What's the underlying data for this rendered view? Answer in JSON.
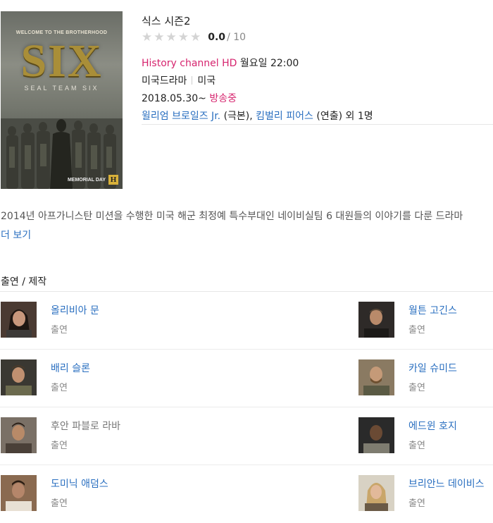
{
  "poster": {
    "tagline": "WELCOME TO THE BROTHERHOOD",
    "title": "SIX",
    "subtitle": "SEAL TEAM SIX",
    "footer": "MEMORIAL DAY",
    "logo": "H"
  },
  "show": {
    "title": "식스 시즌2",
    "rating": {
      "score": "0.0",
      "max": "/ 10",
      "stars_filled": 0,
      "stars_total": 5
    },
    "channel": "History channel HD",
    "schedule": "월요일 22:00",
    "genre": "미국드라마",
    "country": "미국",
    "date": "2018.05.30~",
    "status": "방송중",
    "credits": {
      "writer_name": "윌리엄 브로일즈 Jr.",
      "writer_role": "(극본),",
      "director_name": "킴벌리 피어스",
      "director_role": "(연출)",
      "extra": "외 1명"
    }
  },
  "synopsis": "2014년 아프가니스탄 미션을 수행한 미국 해군 최정예 특수부대인 네이비실팀 6 대원들의 이야기를 다룬 드라마",
  "more_label": "더 보기",
  "cast_section_title": "출연 / 제작",
  "cast": [
    {
      "name": "올리비아 문",
      "role": "출연",
      "linked": true
    },
    {
      "name": "월튼 고긴스",
      "role": "출연",
      "linked": true
    },
    {
      "name": "배리 슬론",
      "role": "출연",
      "linked": true
    },
    {
      "name": "카일 슈미드",
      "role": "출연",
      "linked": true
    },
    {
      "name": "후안 파블로 라바",
      "role": "출연",
      "linked": false
    },
    {
      "name": "에드윈 호지",
      "role": "출연",
      "linked": true
    },
    {
      "name": "도미닉 애덤스",
      "role": "출연",
      "linked": true
    },
    {
      "name": "브리안느 데이비스",
      "role": "출연",
      "linked": true
    }
  ],
  "colors": {
    "accent_pink": "#d6246e",
    "link_blue": "#2a6fc0",
    "star_empty": "#d4d4d4"
  }
}
